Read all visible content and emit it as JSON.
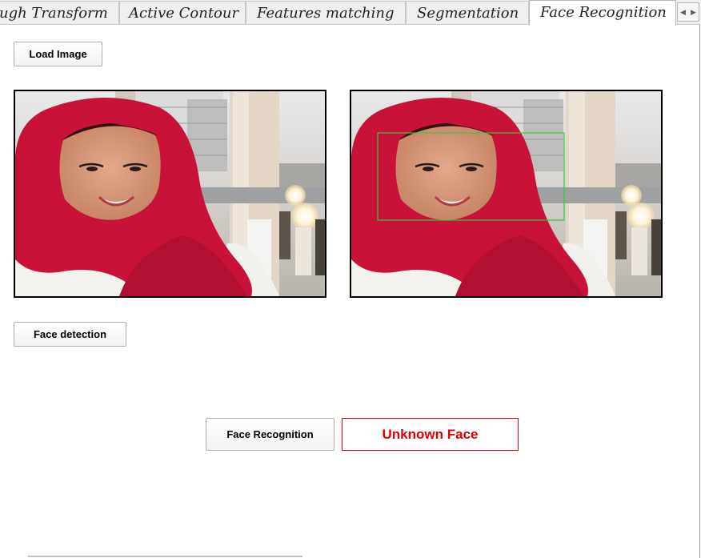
{
  "tabs": [
    {
      "label": "ugh Transform"
    },
    {
      "label": "Active Contour"
    },
    {
      "label": "Features matching"
    },
    {
      "label": "Segmentation"
    },
    {
      "label": "Face Recognition"
    }
  ],
  "active_tab": "Face Recognition",
  "buttons": {
    "load_image": "Load Image",
    "face_detection": "Face detection",
    "face_recognition": "Face Recognition"
  },
  "result": {
    "text": "Unknown Face",
    "color": "#e00000"
  },
  "colors": {
    "hijab": "#c8123a",
    "detection_box": "#3cc63c"
  },
  "icons": [
    "scroll-left-icon",
    "scroll-right-icon"
  ]
}
